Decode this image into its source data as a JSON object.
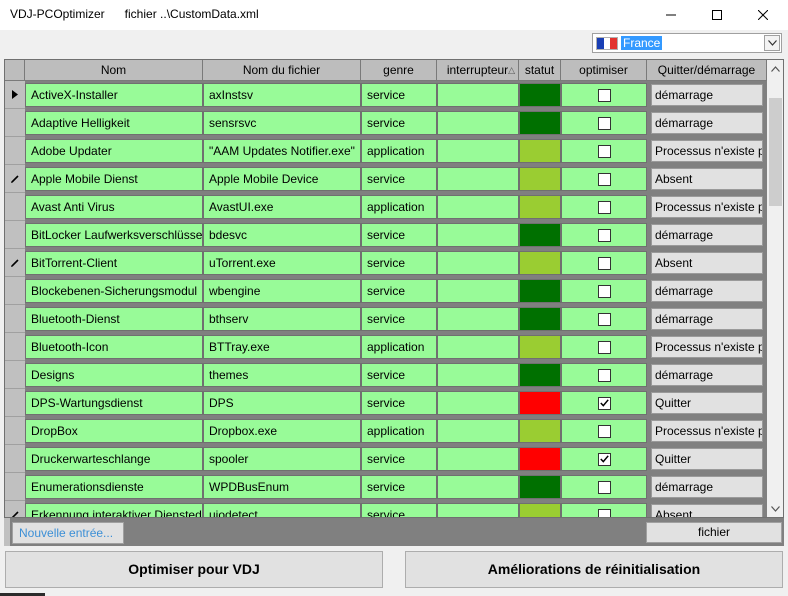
{
  "window": {
    "title": "VDJ-PCOptimizer      fichier ..\\CustomData.xml"
  },
  "language": {
    "selected": "France",
    "flag_colors": [
      "#1a3fb4",
      "#ffffff",
      "#e3342f"
    ]
  },
  "columns": [
    "Nom",
    "Nom du fichier",
    "genre",
    "interrupteur",
    "statut",
    "optimiser",
    "Quitter/démarrage"
  ],
  "colors": {
    "row_bg": "#98fb98",
    "status_dark_green": "#007000",
    "status_light_green": "#9acd32",
    "status_red": "#ff0000"
  },
  "rows": [
    {
      "name": "ActiveX-Installer",
      "file": "axInstsv",
      "genre": "service",
      "switch": "",
      "status_color": "#007000",
      "optimize": false,
      "action": "démarrage",
      "row_icon": "arrow"
    },
    {
      "name": "Adaptive Helligkeit",
      "file": "sensrsvc",
      "genre": "service",
      "switch": "",
      "status_color": "#007000",
      "optimize": false,
      "action": "démarrage",
      "row_icon": ""
    },
    {
      "name": "Adobe Updater",
      "file": "\"AAM Updates Notifier.exe\"",
      "genre": "application",
      "switch": "",
      "status_color": "#9acd32",
      "optimize": false,
      "action": "Processus n'existe p",
      "row_icon": ""
    },
    {
      "name": "Apple Mobile Dienst",
      "file": "Apple Mobile Device",
      "genre": "service",
      "switch": "",
      "status_color": "#9acd32",
      "optimize": false,
      "action": "Absent",
      "row_icon": "pencil"
    },
    {
      "name": "Avast Anti Virus",
      "file": "AvastUI.exe",
      "genre": "application",
      "switch": "",
      "status_color": "#9acd32",
      "optimize": false,
      "action": "Processus n'existe p",
      "row_icon": ""
    },
    {
      "name": "BitLocker Laufwerksverschlüssel",
      "file": "bdesvc",
      "genre": "service",
      "switch": "",
      "status_color": "#007000",
      "optimize": false,
      "action": "démarrage",
      "row_icon": ""
    },
    {
      "name": "BitTorrent-Client",
      "file": "uTorrent.exe",
      "genre": "service",
      "switch": "",
      "status_color": "#9acd32",
      "optimize": false,
      "action": "Absent",
      "row_icon": "pencil"
    },
    {
      "name": "Blockebenen-Sicherungsmodul",
      "file": "wbengine",
      "genre": "service",
      "switch": "",
      "status_color": "#007000",
      "optimize": false,
      "action": "démarrage",
      "row_icon": ""
    },
    {
      "name": "Bluetooth-Dienst",
      "file": "bthserv",
      "genre": "service",
      "switch": "",
      "status_color": "#007000",
      "optimize": false,
      "action": "démarrage",
      "row_icon": ""
    },
    {
      "name": "Bluetooth-Icon",
      "file": "BTTray.exe",
      "genre": "application",
      "switch": "",
      "status_color": "#9acd32",
      "optimize": false,
      "action": "Processus n'existe p",
      "row_icon": ""
    },
    {
      "name": "Designs",
      "file": "themes",
      "genre": "service",
      "switch": "",
      "status_color": "#007000",
      "optimize": false,
      "action": "démarrage",
      "row_icon": ""
    },
    {
      "name": "DPS-Wartungsdienst",
      "file": "DPS",
      "genre": "service",
      "switch": "",
      "status_color": "#ff0000",
      "optimize": true,
      "action": "Quitter",
      "row_icon": ""
    },
    {
      "name": "DropBox",
      "file": "Dropbox.exe",
      "genre": "application",
      "switch": "",
      "status_color": "#9acd32",
      "optimize": false,
      "action": "Processus n'existe p",
      "row_icon": ""
    },
    {
      "name": "Druckerwarteschlange",
      "file": "spooler",
      "genre": "service",
      "switch": "",
      "status_color": "#ff0000",
      "optimize": true,
      "action": "Quitter",
      "row_icon": ""
    },
    {
      "name": "Enumerationsdienste",
      "file": "WPDBusEnum",
      "genre": "service",
      "switch": "",
      "status_color": "#007000",
      "optimize": false,
      "action": "démarrage",
      "row_icon": ""
    },
    {
      "name": "Erkennung interaktiver Dienstedi",
      "file": "uiodetect",
      "genre": "service",
      "switch": "",
      "status_color": "#9acd32",
      "optimize": false,
      "action": "Absent",
      "row_icon": "pencil"
    }
  ],
  "bottom": {
    "new_entry_label": "Nouvelle entrée...",
    "file_label": "fichier",
    "optimize_label": "Optimiser pour VDJ",
    "reset_label": "Améliorations de réinitialisation"
  }
}
